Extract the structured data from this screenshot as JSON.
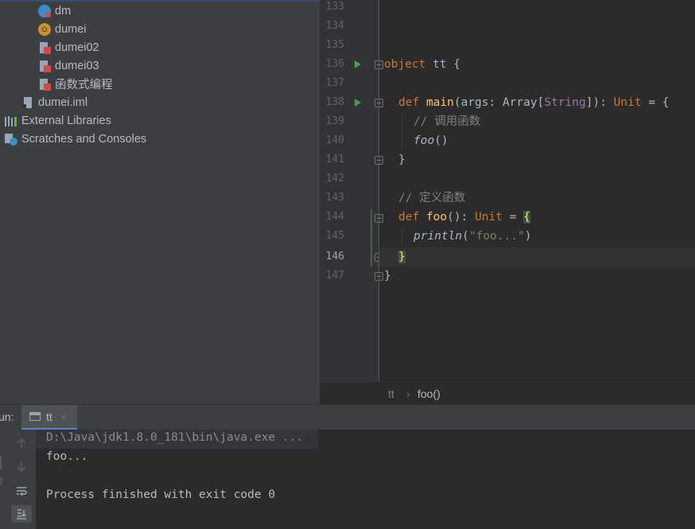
{
  "project_tree": {
    "items": [
      {
        "label": "dm",
        "icon": "scala-object-icon"
      },
      {
        "label": "dumei",
        "icon": "scala-class-icon"
      },
      {
        "label": "dumei02",
        "icon": "scala-file-icon"
      },
      {
        "label": "dumei03",
        "icon": "scala-file-icon"
      },
      {
        "label": "函数式编程",
        "icon": "scala-file-icon"
      },
      {
        "label": "dumei.iml",
        "icon": "module-file-icon"
      },
      {
        "label": "External Libraries",
        "icon": "libraries-icon"
      },
      {
        "label": "Scratches and Consoles",
        "icon": "scratches-icon"
      }
    ]
  },
  "editor": {
    "line_numbers": [
      "133",
      "134",
      "135",
      "136",
      "137",
      "138",
      "139",
      "140",
      "141",
      "142",
      "143",
      "144",
      "145",
      "146",
      "147"
    ],
    "current_line": "146",
    "code": {
      "l136_kw": "object",
      "l136_rest": " tt {",
      "l138_kw": "def",
      "l138_fn": "main",
      "l138_a": "(args: Array[",
      "l138_type": "String",
      "l138_b": "]): ",
      "l138_unit": "Unit",
      "l138_c": " = {",
      "l139_comment": "// 调用函数",
      "l140_call": "foo",
      "l140_rest": "()",
      "l141": "}",
      "l143_comment": "// 定义函数",
      "l144_kw": "def",
      "l144_fn": "foo",
      "l144_a": "(): ",
      "l144_unit": "Unit",
      "l144_b": " = ",
      "l144_brace": "{",
      "l145_call": "println",
      "l145_a": "(",
      "l145_str": "\"foo...\"",
      "l145_b": ")",
      "l146_brace": "}",
      "l147": "}"
    }
  },
  "breadcrumb": {
    "items": [
      "tt",
      "foo()"
    ],
    "separator": "›"
  },
  "run_panel": {
    "label": "un:",
    "tab_label": "tt",
    "close": "×",
    "output": [
      "D:\\Java\\jdk1.8.0_181\\bin\\java.exe ...",
      "foo...",
      "",
      "Process finished with exit code 0"
    ]
  },
  "colors": {
    "keyword": "#cc7832",
    "function": "#ffc66d",
    "string": "#6a8759",
    "comment": "#808080",
    "run_marker": "#499c54"
  }
}
